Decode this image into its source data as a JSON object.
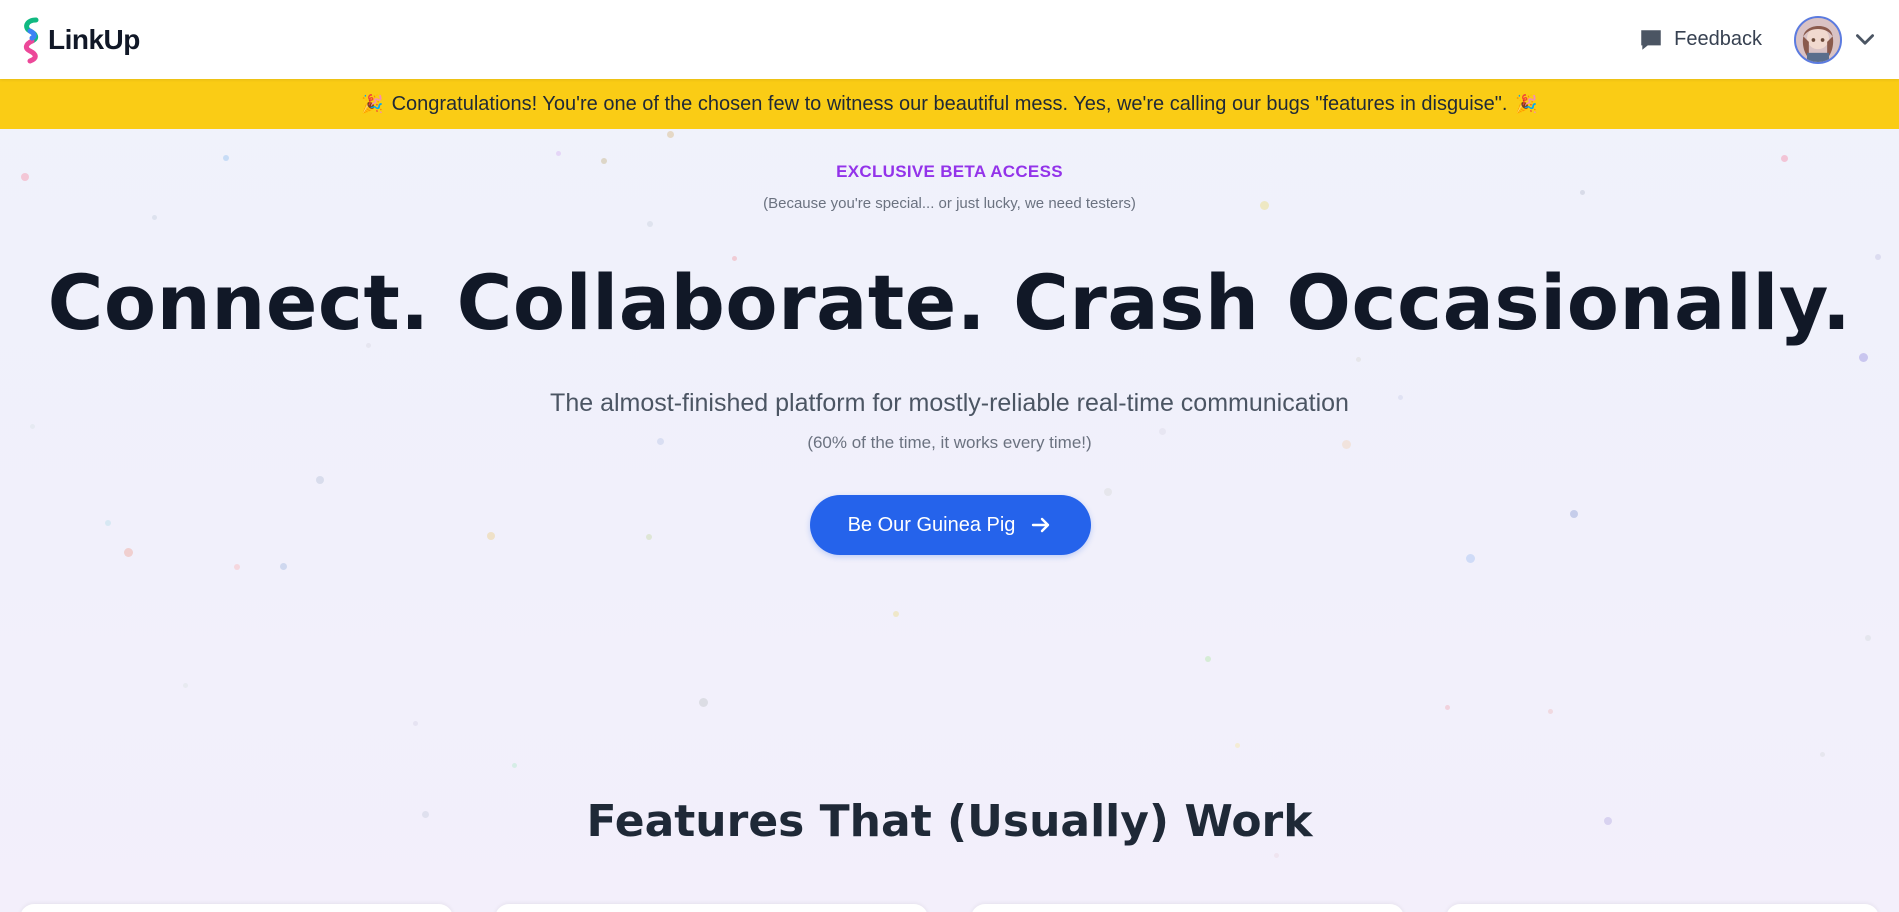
{
  "header": {
    "brand_name": "LinkUp",
    "feedback_label": "Feedback"
  },
  "banner": {
    "message": "Congratulations! You're one of the chosen few to witness our beautiful mess. Yes, we're calling our bugs \"features in disguise\".",
    "emoji": "🎉"
  },
  "hero": {
    "eyebrow": "EXCLUSIVE BETA ACCESS",
    "eyebrow_sub": "(Because you're special... or just lucky, we need testers)",
    "headline": "Connect. Collaborate. Crash Occasionally.",
    "subheadline": "The almost-finished platform for mostly-reliable real-time communication",
    "subnote": "(60% of the time, it works every time!)",
    "cta_label": "Be Our Guinea Pig"
  },
  "features": {
    "title": "Features That (Usually) Work"
  },
  "colors": {
    "accent": "#2563eb",
    "banner": "#facc15",
    "eyebrow": "#9333ea"
  },
  "icons": {
    "logo": "linkup-logo-icon",
    "feedback": "chat-bubble-icon",
    "avatar": "user-avatar",
    "chevron": "chevron-down-icon",
    "cta": "arrow-right-icon"
  }
}
